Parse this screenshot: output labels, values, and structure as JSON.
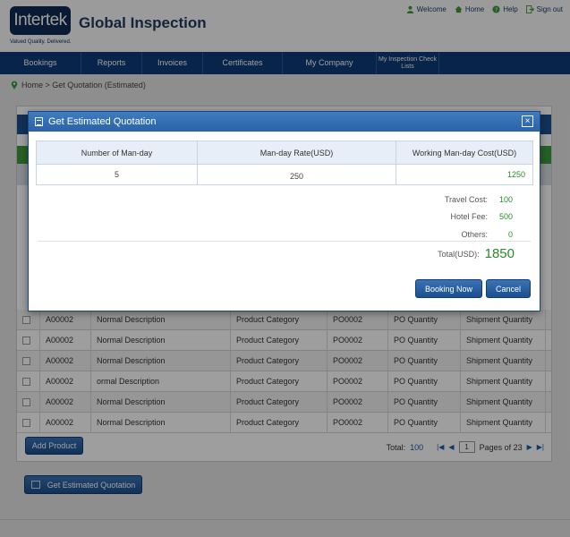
{
  "header": {
    "logo_text": "Intertek",
    "tagline": "Valued Quality. Delivered.",
    "app_title": "Global Inspection",
    "links": [
      {
        "label": "Welcome",
        "icon": "user-icon"
      },
      {
        "label": "Home",
        "icon": "home-icon"
      },
      {
        "label": "Help",
        "icon": "help-icon"
      },
      {
        "label": "Sign out",
        "icon": "sign-out-icon"
      }
    ]
  },
  "nav": {
    "items": [
      "Bookings",
      "Reports",
      "Invoices",
      "Certificates",
      "My Company",
      "My Inspection Check Lists"
    ]
  },
  "breadcrumb": {
    "text": "Home > Get Quotation (Estimated)"
  },
  "background_table": {
    "rows": [
      [
        "A00002",
        "Normal Description",
        "Product Category",
        "PO0002",
        "PO Quantity",
        "Shipment Quantity"
      ],
      [
        "A00002",
        "Normal Description",
        "Product Category",
        "PO0002",
        "PO Quantity",
        "Shipment Quantity"
      ],
      [
        "A00002",
        "Normal Description",
        "Product Category",
        "PO0002",
        "PO Quantity",
        "Shipment Quantity"
      ],
      [
        "A00002",
        "ormal Description",
        "Product Category",
        "PO0002",
        "PO Quantity",
        "Shipment Quantity"
      ],
      [
        "A00002",
        "Normal Description",
        "Product Category",
        "PO0002",
        "PO Quantity",
        "Shipment Quantity"
      ],
      [
        "A00002",
        "Normal Description",
        "Product Category",
        "PO0002",
        "PO Quantity",
        "Shipment Quantity"
      ]
    ],
    "add_product_label": "Add Product",
    "pager": {
      "total_label": "Total:",
      "total": "100",
      "page": "1",
      "pages_label": "Pages of 23"
    }
  },
  "estimate_button_label": "Get Estimated Quotation",
  "modal": {
    "title": "Get Estimated Quotation",
    "close_symbol": "×",
    "columns": [
      "Number of Man-day",
      "Man-day Rate(USD)",
      "Working Man-day Cost(USD)"
    ],
    "row": {
      "man_days": "5",
      "rate": "250",
      "cost": "1250"
    },
    "summary": [
      {
        "label": "Travel Cost:",
        "value": "100"
      },
      {
        "label": "Hotel Fee:",
        "value": "500"
      },
      {
        "label": "Others:",
        "value": "0"
      }
    ],
    "total_label": "Total(USD):",
    "total_value": "1850",
    "book_label": "Booking Now",
    "cancel_label": "Cancel"
  },
  "colors": {
    "brand_navy": "#0e3a7a",
    "accent_green": "#2a8a2a",
    "button_blue": "#1b4f8e"
  }
}
